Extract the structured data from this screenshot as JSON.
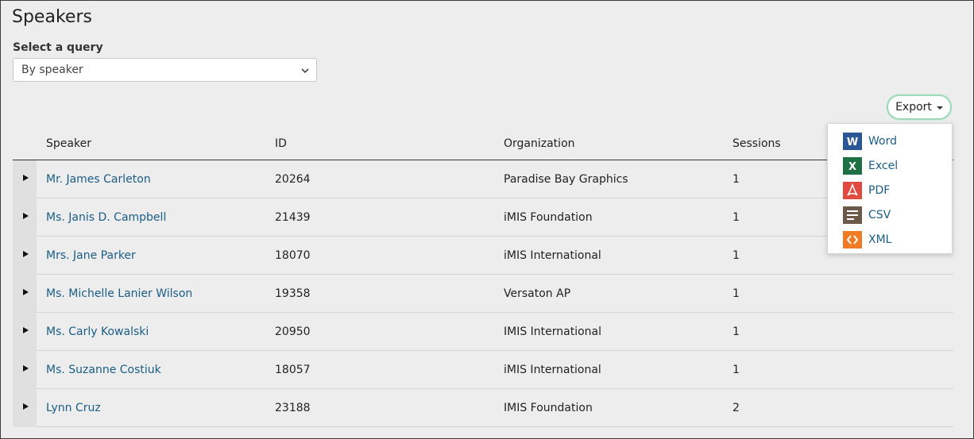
{
  "page": {
    "title": "Speakers"
  },
  "query": {
    "label": "Select a query",
    "selected": "By speaker"
  },
  "export": {
    "label": "Export",
    "menu": [
      {
        "label": "Word",
        "icon": "word-icon",
        "color": "#2b5797"
      },
      {
        "label": "Excel",
        "icon": "excel-icon",
        "color": "#1e7145"
      },
      {
        "label": "PDF",
        "icon": "pdf-icon",
        "color": "#e04a3f"
      },
      {
        "label": "CSV",
        "icon": "csv-icon",
        "color": "#6b5a47"
      },
      {
        "label": "XML",
        "icon": "xml-icon",
        "color": "#f07b24"
      }
    ]
  },
  "table": {
    "columns": [
      "Speaker",
      "ID",
      "Organization",
      "Sessions"
    ],
    "rows": [
      {
        "speaker": "Mr. James Carleton",
        "id": "20264",
        "org": "Paradise Bay Graphics",
        "sessions": "1"
      },
      {
        "speaker": "Ms. Janis D. Campbell",
        "id": "21439",
        "org": "iMIS Foundation",
        "sessions": "1"
      },
      {
        "speaker": "Mrs. Jane Parker",
        "id": "18070",
        "org": "iMIS International",
        "sessions": "1"
      },
      {
        "speaker": "Ms. Michelle Lanier Wilson",
        "id": "19358",
        "org": "Versaton AP",
        "sessions": "1"
      },
      {
        "speaker": "Ms. Carly Kowalski",
        "id": "20950",
        "org": "IMIS International",
        "sessions": "1"
      },
      {
        "speaker": "Ms. Suzanne Costiuk",
        "id": "18057",
        "org": "iMIS International",
        "sessions": "1"
      },
      {
        "speaker": "Lynn Cruz",
        "id": "23188",
        "org": "IMIS Foundation",
        "sessions": "2"
      }
    ]
  },
  "colors": {
    "link": "#1a5d86",
    "panel_bg": "#ededed",
    "export_border": "#9ed8b6"
  }
}
